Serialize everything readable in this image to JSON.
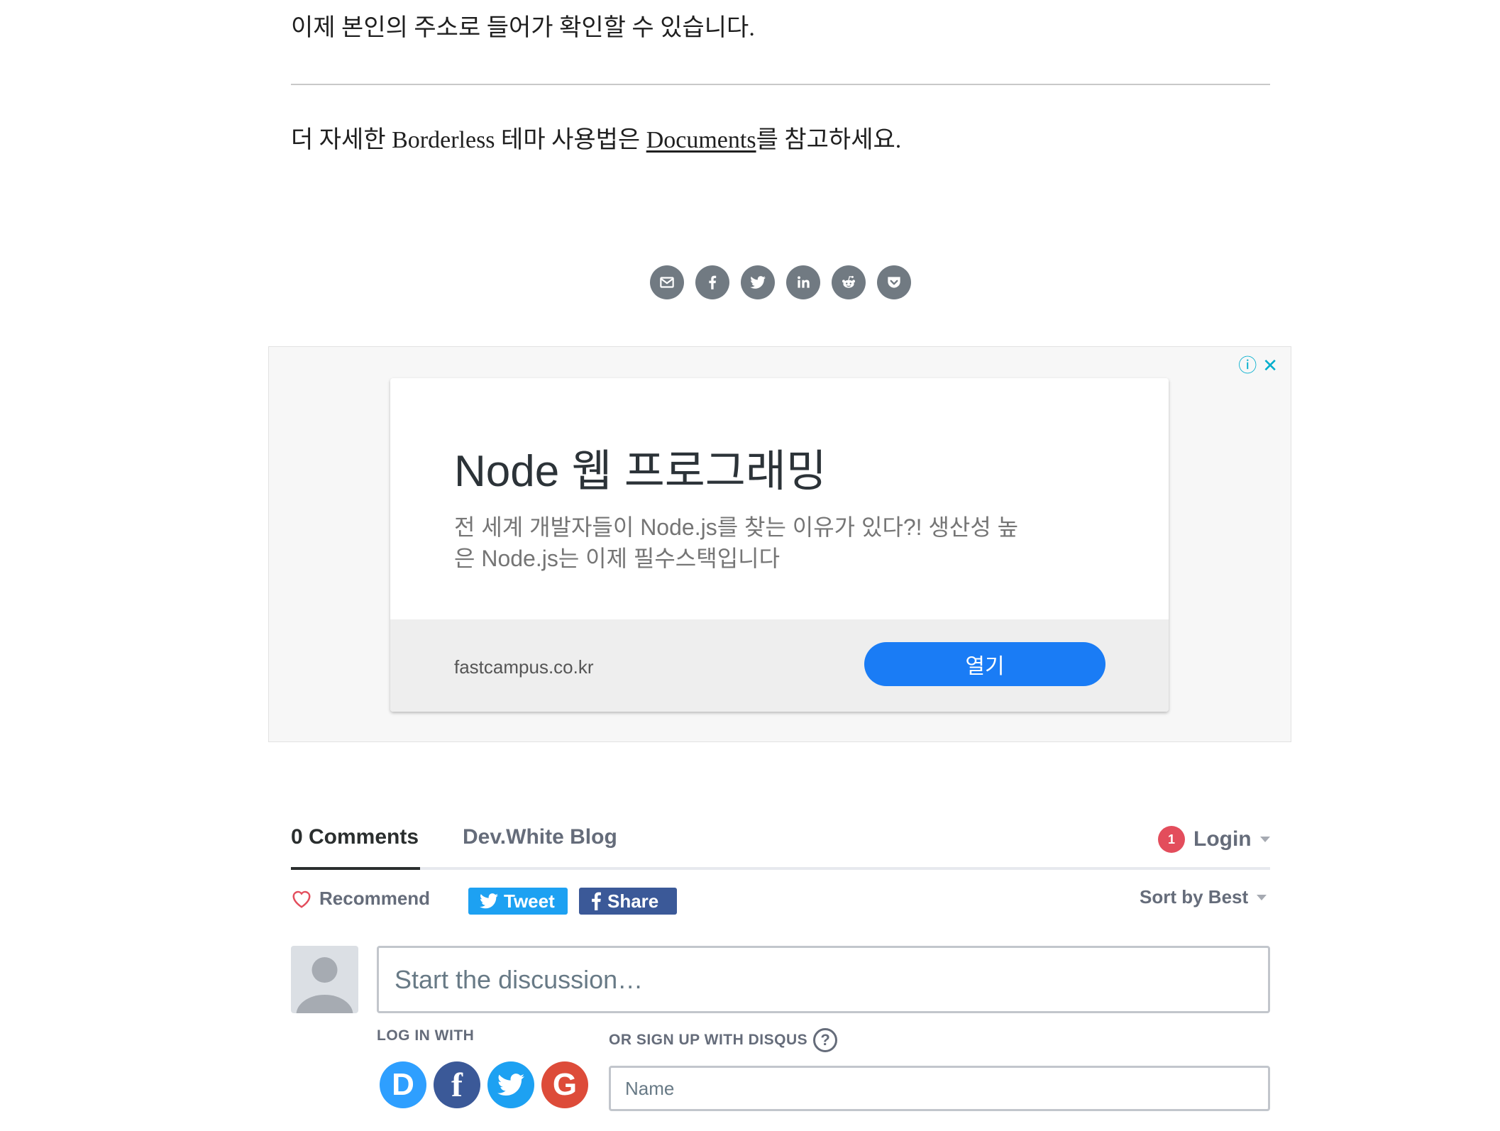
{
  "article": {
    "line1": "이제 본인의 주소로 들어가 확인할 수 있습니다.",
    "line2_prefix": "더 자세한 Borderless 테마 사용법은 ",
    "line2_link": "Documents",
    "line2_suffix": "를 참고하세요."
  },
  "share_icons": [
    "mail-icon",
    "facebook-icon",
    "twitter-icon",
    "linkedin-icon",
    "reddit-icon",
    "pocket-icon"
  ],
  "ad": {
    "info_icon": "ⓘ",
    "close_icon": "✕",
    "title": "Node 웹 프로그래밍",
    "description": "전 세계 개발자들이 Node.js를 찾는 이유가 있다?! 생산성 높은 Node.js는 이제 필수스택입니다",
    "domain": "fastcampus.co.kr",
    "button_label": "열기",
    "accent_color": "#1a7cf5"
  },
  "disqus": {
    "tab_comments": "0 Comments",
    "tab_blog": "Dev.White Blog",
    "notification_count": "1",
    "login_label": "Login",
    "recommend_label": "Recommend",
    "tweet_label": "Tweet",
    "share_label": "Share",
    "sort_label": "Sort by Best",
    "discussion_placeholder": "Start the discussion…",
    "login_with_label": "LOG IN WITH",
    "signup_label": "OR SIGN UP WITH DISQUS",
    "help_icon_text": "?",
    "name_placeholder": "Name",
    "social_logins": [
      {
        "name": "disqus",
        "letter": "D",
        "color": "#2e9fff"
      },
      {
        "name": "facebook",
        "letter": "f",
        "color": "#3b5998"
      },
      {
        "name": "twitter",
        "letter": "t",
        "color": "#1da1f2"
      },
      {
        "name": "google",
        "letter": "G",
        "color": "#dd4b39"
      }
    ]
  }
}
